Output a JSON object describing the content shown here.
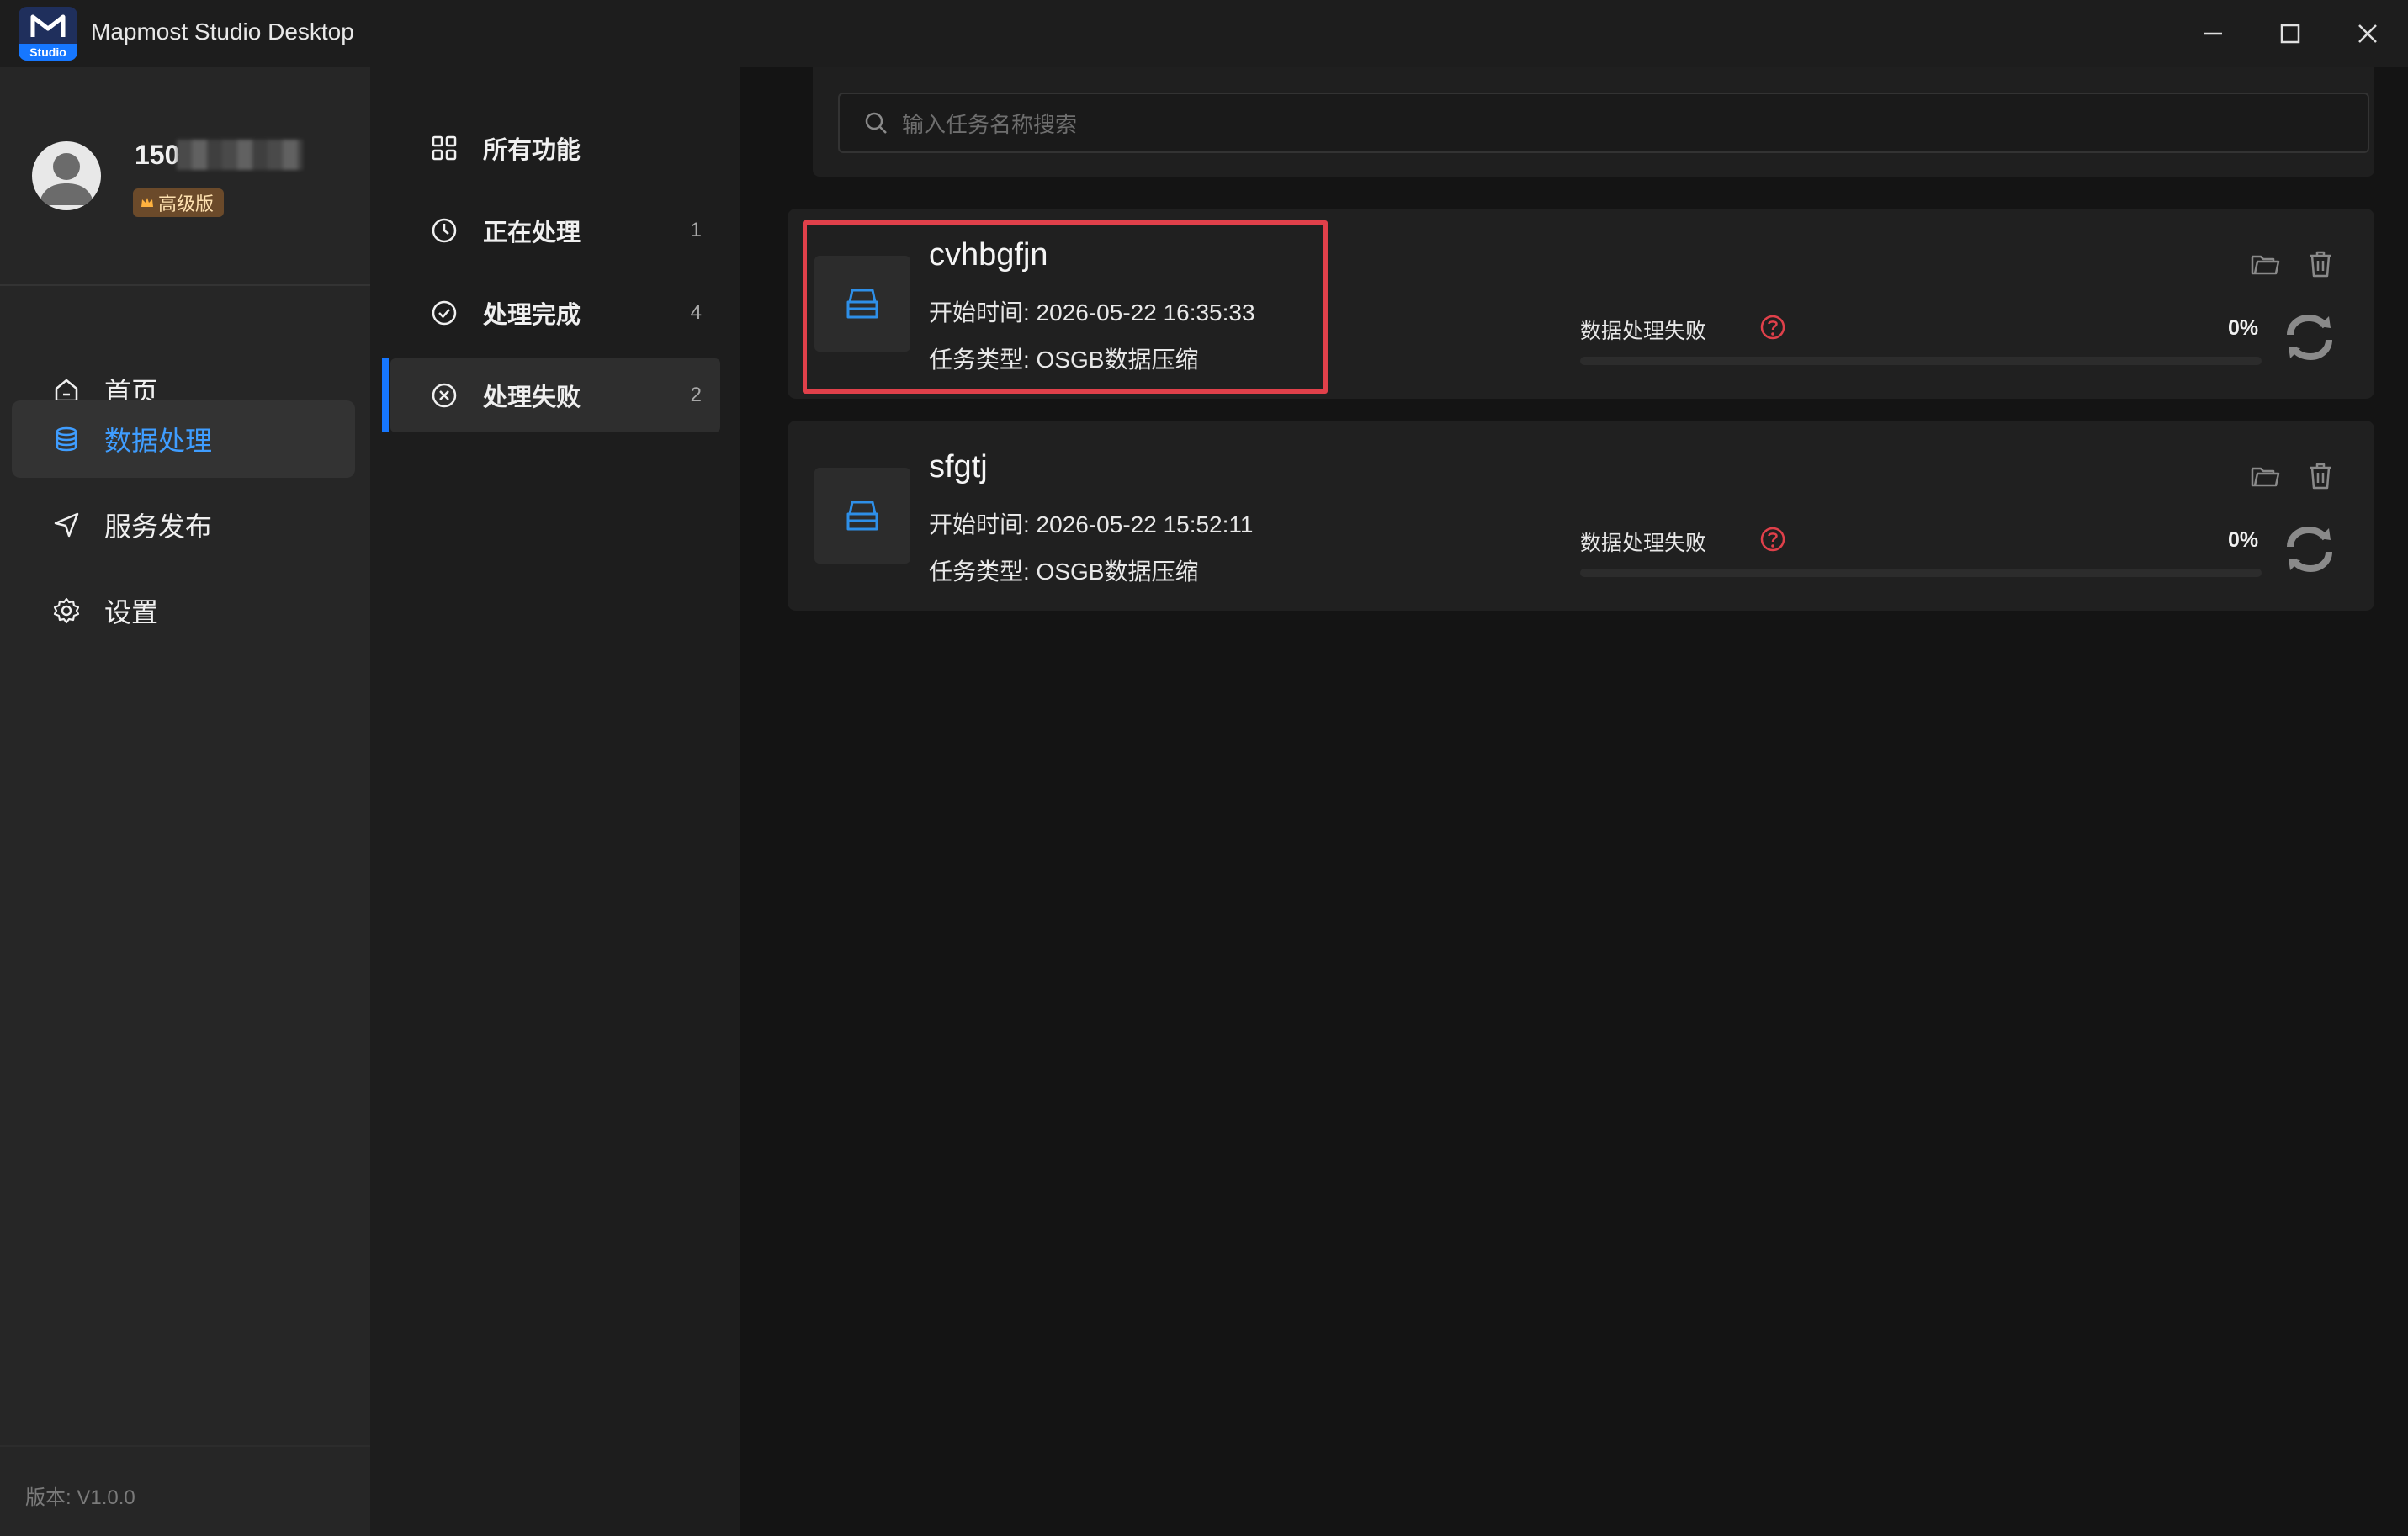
{
  "window": {
    "title": "Mapmost Studio Desktop",
    "logo_badge": "Studio",
    "controls": [
      "minimize-icon",
      "maximize-icon",
      "close-icon"
    ]
  },
  "user": {
    "name_prefix": "150",
    "tier": "高级版"
  },
  "sidebar": {
    "items": [
      {
        "label": "首页",
        "icon": "home-icon"
      },
      {
        "label": "数据处理",
        "icon": "database-icon",
        "active": true
      },
      {
        "label": "服务发布",
        "icon": "send-icon"
      },
      {
        "label": "设置",
        "icon": "gear-icon"
      }
    ],
    "version": "版本: V1.0.0"
  },
  "subnav": {
    "items": [
      {
        "label": "所有功能",
        "icon": "grid-icon",
        "count": ""
      },
      {
        "label": "正在处理",
        "icon": "clock-icon",
        "count": "1"
      },
      {
        "label": "处理完成",
        "icon": "check-circle-icon",
        "count": "4"
      },
      {
        "label": "处理失败",
        "icon": "x-circle-icon",
        "count": "2",
        "active": true
      }
    ]
  },
  "search": {
    "placeholder": "输入任务名称搜索"
  },
  "tasks": [
    {
      "name": "cvhbgfjn",
      "start_time": "开始时间: 2026-05-22 16:35:33",
      "task_type": "任务类型: OSGB数据压缩",
      "status": "数据处理失败",
      "percent": "0%",
      "progress": 0
    },
    {
      "name": "sfgtj",
      "start_time": "开始时间: 2026-05-22 15:52:11",
      "task_type": "任务类型: OSGB数据压缩",
      "status": "数据处理失败",
      "percent": "0%",
      "progress": 0
    }
  ],
  "colors": {
    "accent": "#1677ff",
    "active_text": "#3f9dff",
    "error": "#e0404a",
    "tier_badge": "#6b4a2a"
  }
}
